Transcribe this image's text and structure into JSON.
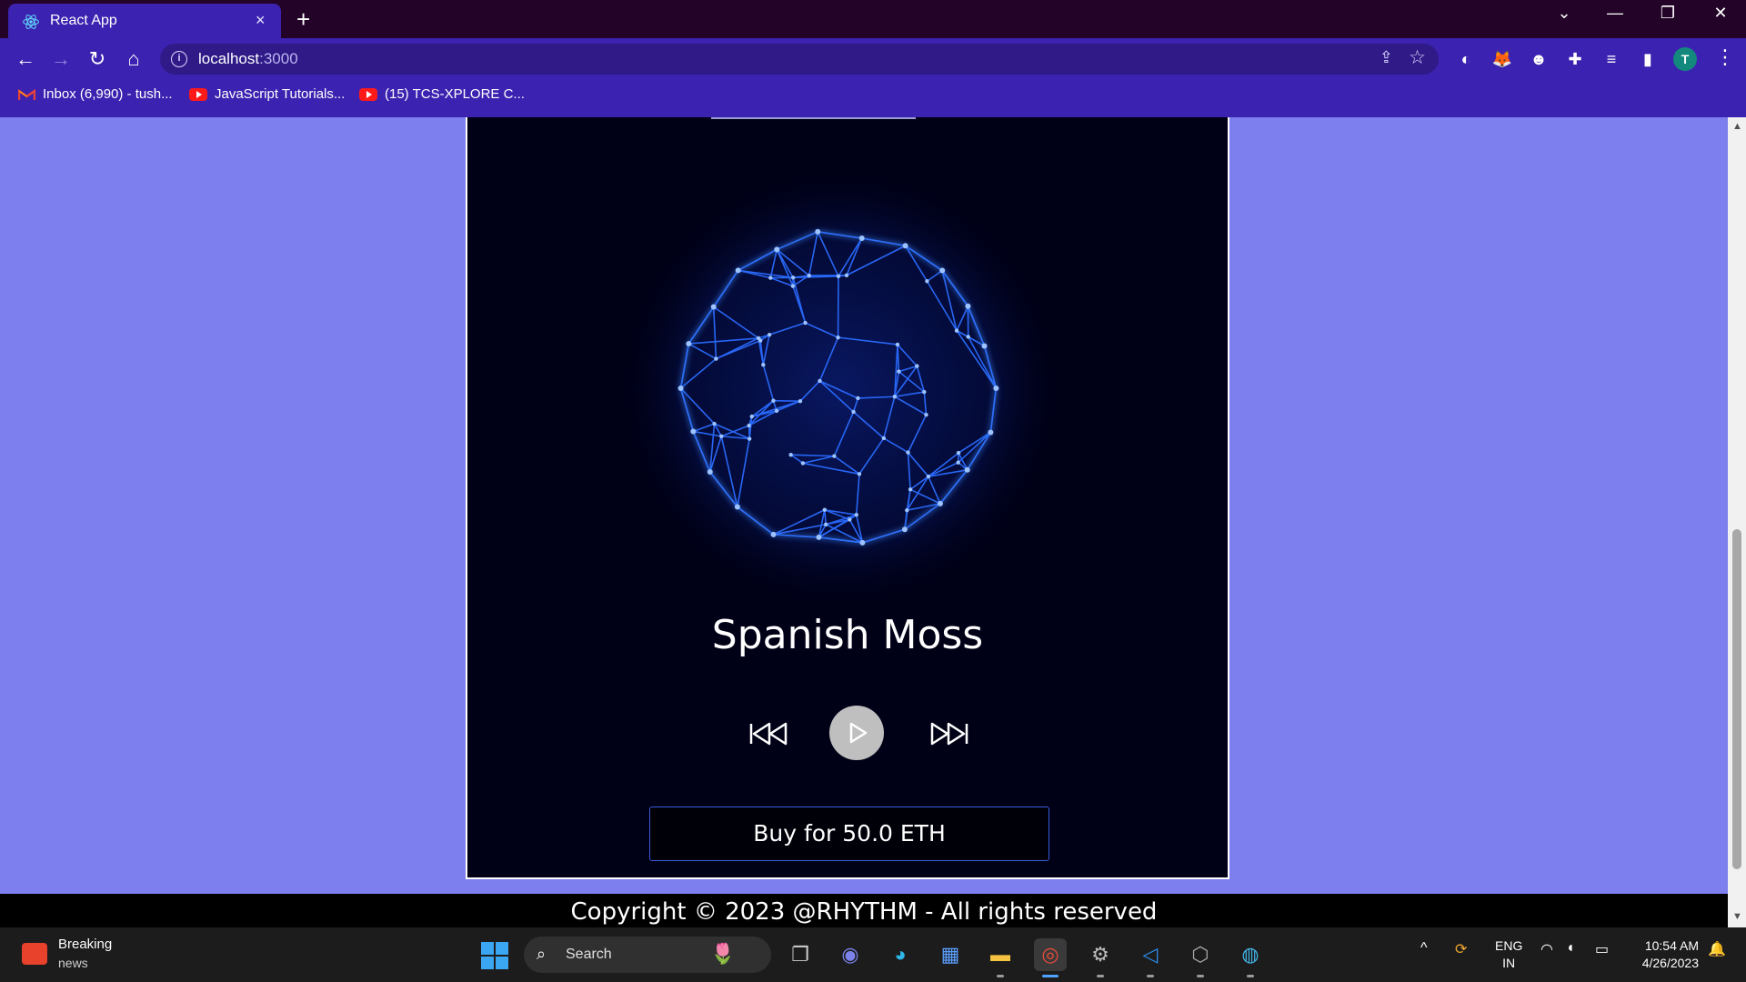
{
  "browser": {
    "tab_title": "React App",
    "tab_close": "×",
    "new_tab": "+",
    "url_host": "localhost",
    "url_port": ":3000",
    "avatar_letter": "T",
    "bookmarks": [
      {
        "label": "Inbox (6,990) - tush..."
      },
      {
        "label": "JavaScript Tutorials..."
      },
      {
        "label": "(15) TCS-XPLORE C..."
      }
    ]
  },
  "player": {
    "song_title": "Spanish Moss",
    "buy_label": "Buy for 50.0 ETH",
    "price_eth": 50.0
  },
  "footer": {
    "copyright": "Copyright © 2023 @RHYTHM - All rights reserved"
  },
  "taskbar": {
    "news_title": "Breaking",
    "news_sub": "news",
    "search_label": "Search",
    "lang_top": "ENG",
    "lang_bottom": "IN",
    "time": "10:54 AM",
    "date": "4/26/2023"
  },
  "colors": {
    "page_bg": "#7e7fef",
    "browser_toolbar": "#3c22b0",
    "card_bg": "#000016",
    "orb_glow": "#2a6bff"
  }
}
